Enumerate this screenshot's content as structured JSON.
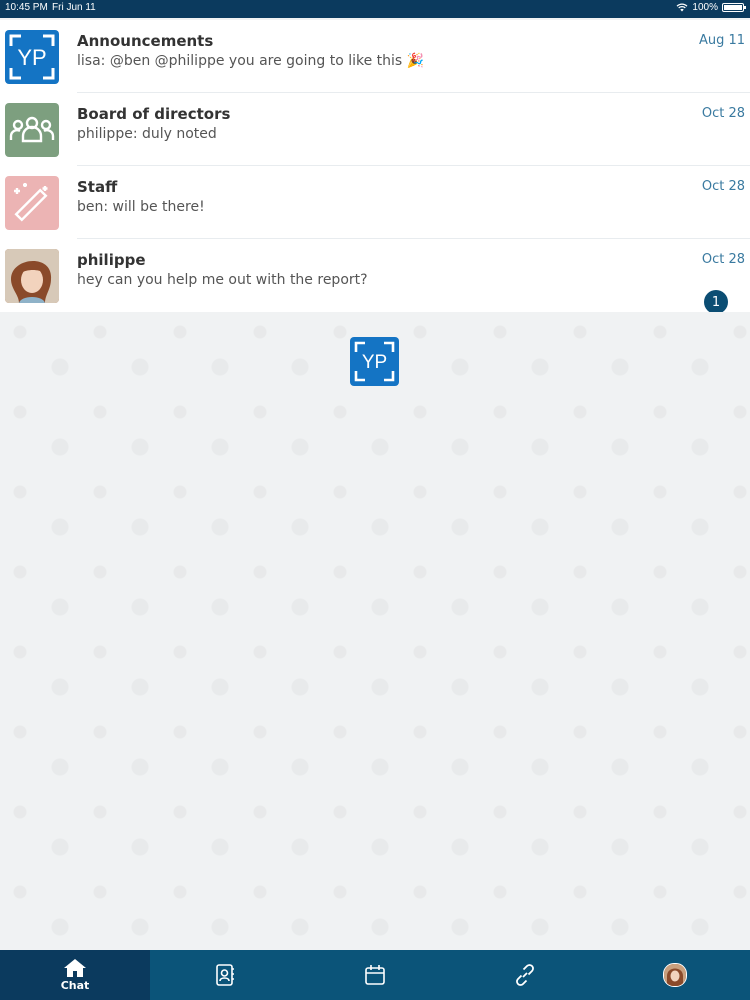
{
  "status_bar": {
    "time": "10:45 PM",
    "date": "Fri Jun 11",
    "battery": "100%",
    "battery_level": 1.0
  },
  "chats": [
    {
      "name": "Announcements",
      "preview": "lisa: @ben @philippe you are going to like this 🎉",
      "date": "Aug 11",
      "avatar": "yp-logo-icon"
    },
    {
      "name": "Board of directors",
      "preview": "philippe: duly noted",
      "date": "Oct 28",
      "avatar": "group-icon"
    },
    {
      "name": "Staff",
      "preview": "ben: will be there!",
      "date": "Oct 28",
      "avatar": "magic-wand-icon"
    },
    {
      "name": "philippe",
      "preview": "hey can you help me out with the report?",
      "date": "Oct 28",
      "avatar": "user-photo",
      "unread": "1"
    }
  ],
  "center_logo": {
    "text": "YP"
  },
  "tabbar": {
    "tabs": [
      {
        "label": "Chat",
        "icon": "home-icon",
        "active": true
      },
      {
        "label": "",
        "icon": "contacts-icon"
      },
      {
        "label": "",
        "icon": "calendar-icon"
      },
      {
        "label": "",
        "icon": "link-icon"
      },
      {
        "label": "",
        "icon": "profile-avatar"
      }
    ]
  },
  "colors": {
    "header": "#0b3a5e",
    "tabbar": "#0b5479",
    "accent": "#3a7aa0",
    "yp_blue": "#1474c4"
  }
}
